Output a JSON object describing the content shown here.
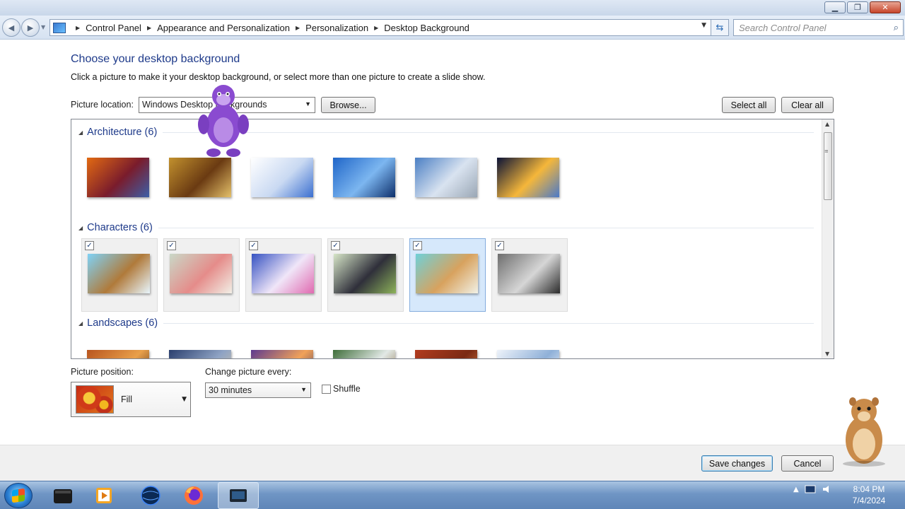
{
  "window": {
    "min_glyph": "▁",
    "max_glyph": "❐",
    "close_glyph": "✕"
  },
  "nav": {
    "breadcrumb": [
      "Control Panel",
      "Appearance and Personalization",
      "Personalization",
      "Desktop Background"
    ],
    "search_placeholder": "Search Control Panel"
  },
  "content": {
    "title": "Choose your desktop background",
    "description": "Click a picture to make it your desktop background, or select more than one picture to create a slide show.",
    "picture_location_label": "Picture location:",
    "picture_location_value": "Windows Desktop Backgrounds",
    "browse_label": "Browse...",
    "select_all_label": "Select all",
    "clear_all_label": "Clear all"
  },
  "groups": [
    {
      "name": "Architecture (6)",
      "items": [
        {
          "selected": false,
          "colors": [
            "#e26a12",
            "#7a1c2c",
            "#3c5fa8"
          ]
        },
        {
          "selected": false,
          "colors": [
            "#c2912e",
            "#6a3a12",
            "#e5c16a"
          ]
        },
        {
          "selected": false,
          "colors": [
            "#ffffff",
            "#c9d9f2",
            "#3b6fd0"
          ]
        },
        {
          "selected": false,
          "colors": [
            "#1f65c8",
            "#7cb6f0",
            "#0d2f6b"
          ]
        },
        {
          "selected": false,
          "colors": [
            "#4b7fc4",
            "#d9e3f0",
            "#9aa7b5"
          ]
        },
        {
          "selected": false,
          "colors": [
            "#0a1236",
            "#f5b73a",
            "#4a79c9"
          ]
        }
      ]
    },
    {
      "name": "Characters (6)",
      "items": [
        {
          "selected": true,
          "colors": [
            "#7fd2f7",
            "#b07a3a",
            "#e8f6fd"
          ]
        },
        {
          "selected": true,
          "colors": [
            "#c9d8c7",
            "#e58c8a",
            "#f2efe6"
          ]
        },
        {
          "selected": true,
          "colors": [
            "#3552c2",
            "#f0e6f8",
            "#e06ab0"
          ]
        },
        {
          "selected": true,
          "colors": [
            "#d7e6c8",
            "#2f2f3a",
            "#8db35a"
          ]
        },
        {
          "selected": true,
          "colors": [
            "#6fd0d8",
            "#d8a25e",
            "#f1f1e6"
          ]
        },
        {
          "selected": true,
          "colors": [
            "#6e6e6e",
            "#d6d6d6",
            "#2b2b2b"
          ]
        }
      ]
    },
    {
      "name": "Landscapes (6)",
      "items": [
        {
          "selected": false,
          "colors": [
            "#b8551f",
            "#e9a04a",
            "#3b1a0e"
          ]
        },
        {
          "selected": false,
          "colors": [
            "#2a3f6e",
            "#8fa3c4",
            "#d8c9a6"
          ]
        },
        {
          "selected": false,
          "colors": [
            "#5d3a8f",
            "#f1a259",
            "#2f2a5c"
          ]
        },
        {
          "selected": false,
          "colors": [
            "#3f6e3a",
            "#e2e9e6",
            "#7a5a2a"
          ]
        },
        {
          "selected": false,
          "colors": [
            "#b23c1f",
            "#7a2a14",
            "#e48a4a"
          ]
        },
        {
          "selected": false,
          "colors": [
            "#eef3fa",
            "#8fb0d8",
            "#ffffff"
          ]
        }
      ]
    }
  ],
  "options": {
    "position_label": "Picture position:",
    "position_value": "Fill",
    "interval_label": "Change picture every:",
    "interval_value": "30 minutes",
    "shuffle_label": "Shuffle",
    "shuffle_checked": false
  },
  "footer": {
    "save_label": "Save changes",
    "cancel_label": "Cancel"
  },
  "clock": {
    "time": "8:04 PM",
    "date": "7/4/2024"
  }
}
